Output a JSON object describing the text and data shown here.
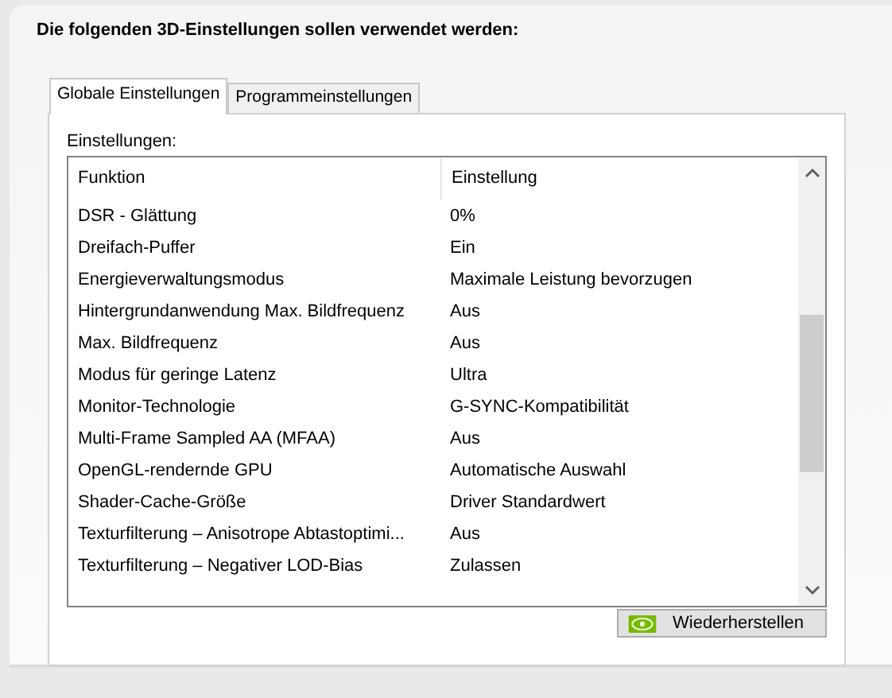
{
  "heading": "Die folgenden 3D-Einstellungen sollen verwendet werden:",
  "tabs": [
    {
      "label": "Globale Einstellungen",
      "selected": true
    },
    {
      "label": "Programmeinstellungen",
      "selected": false
    }
  ],
  "settings_label": "Einstellungen:",
  "table": {
    "columns": [
      "Funktion",
      "Einstellung"
    ],
    "rows": [
      [
        "DSR - Glättung",
        "0%"
      ],
      [
        "Dreifach-Puffer",
        "Ein"
      ],
      [
        "Energieverwaltungsmodus",
        "Maximale Leistung bevorzugen"
      ],
      [
        "Hintergrundanwendung Max. Bildfrequenz",
        "Aus"
      ],
      [
        "Max. Bildfrequenz",
        "Aus"
      ],
      [
        "Modus für geringe Latenz",
        "Ultra"
      ],
      [
        "Monitor-Technologie",
        "G-SYNC-Kompatibilität"
      ],
      [
        "Multi-Frame Sampled AA (MFAA)",
        "Aus"
      ],
      [
        "OpenGL-rendernde GPU",
        "Automatische Auswahl"
      ],
      [
        "Shader-Cache-Größe",
        "Driver Standardwert"
      ],
      [
        "Texturfilterung – Anisotrope Abtastoptimi...",
        "Aus"
      ],
      [
        "Texturfilterung – Negativer LOD-Bias",
        "Zulassen"
      ]
    ]
  },
  "restore_button": "Wiederherstellen"
}
